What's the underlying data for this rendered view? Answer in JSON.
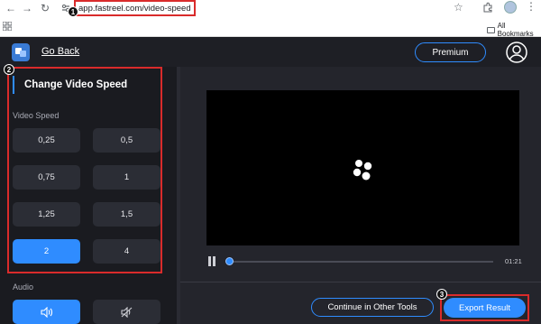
{
  "browser": {
    "url": "app.fastreel.com/video-speed",
    "bookmarks_label": "All Bookmarks",
    "back_icon": "←",
    "forward_icon": "→",
    "reload_icon": "↻",
    "star_icon": "☆",
    "kebab_icon": "⋮"
  },
  "annotations": {
    "one": "1",
    "two": "2",
    "three": "3"
  },
  "header": {
    "go_back": "Go Back",
    "premium": "Premium"
  },
  "sidebar": {
    "title": "Change Video Speed",
    "video_speed_label": "Video Speed",
    "speeds": [
      "0,25",
      "0,5",
      "0,75",
      "1",
      "1,25",
      "1,5",
      "2",
      "4"
    ],
    "selected_speed": "2",
    "audio_label": "Audio"
  },
  "player": {
    "time": "01:21",
    "progress": 0.01
  },
  "actions": {
    "continue": "Continue in Other Tools",
    "export": "Export Result"
  },
  "colors": {
    "accent": "#2f8cff",
    "annotation_red": "#d92b2b",
    "background": "#1a1b20"
  }
}
